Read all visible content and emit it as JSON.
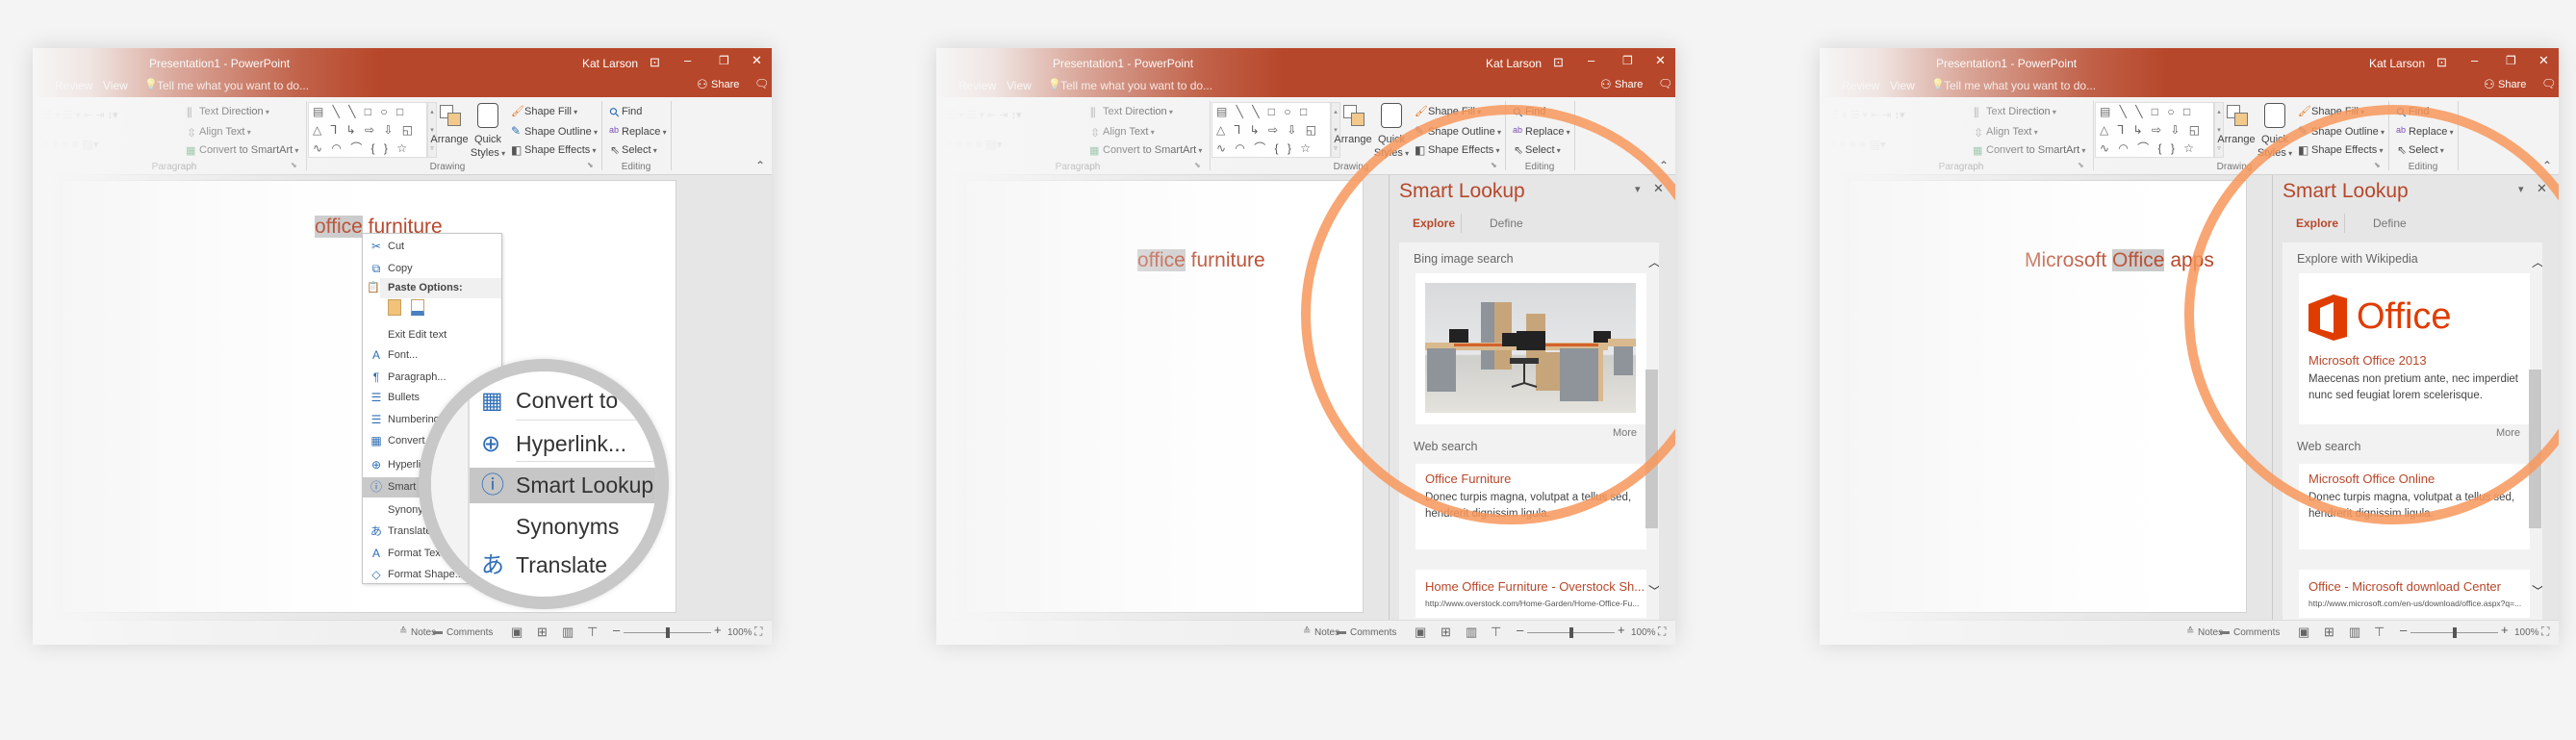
{
  "window": {
    "title": "Presentation1 - PowerPoint",
    "user": "Kat Larson",
    "tabs": [
      "Review",
      "View"
    ],
    "tell_me": "Tell me what you want to do...",
    "share": "Share"
  },
  "ribbon": {
    "text_direction": "Text Direction",
    "align_text": "Align Text",
    "convert_smartart": "Convert to SmartArt",
    "paragraph_group": "Paragraph",
    "shape_gallery_rows": [
      "▤ ╲ ╲ □ ○ □",
      "△ ⅂ ↳ ⇨ ⇩ ◱",
      "∿ ◠ ⌒ { } ☆"
    ],
    "arrange": "Arrange",
    "quick_styles_1": "Quick",
    "quick_styles_2": "Styles",
    "shape_fill": "Shape Fill",
    "shape_outline": "Shape Outline",
    "shape_effects": "Shape Effects",
    "drawing_group": "Drawing",
    "find": "Find",
    "replace": "Replace",
    "select": "Select",
    "editing_group": "Editing"
  },
  "status_bar": {
    "notes": "Notes",
    "comments": "Comments",
    "zoom": "100%",
    "zoom_slider_fraction": 0.5
  },
  "colors": {
    "accent": "#b7472a",
    "highlight_ring": "#f7965a",
    "magnifier_ring": "#c8c8c8"
  },
  "panels": [
    {
      "slide_text": {
        "before": "",
        "highlight": "office",
        "after": " furniture"
      },
      "context_menu": [
        {
          "label": "Cut",
          "icon": "cut-icon"
        },
        {
          "label": "Copy",
          "icon": "copy-icon"
        },
        {
          "label": "Paste Options:",
          "icon": "paste-icon",
          "header": true
        },
        {
          "label": "",
          "icon": "paste-options-icon"
        },
        {
          "label": "Exit Edit text",
          "icon": ""
        },
        {
          "label": "Font...",
          "icon": "font-icon"
        },
        {
          "label": "Paragraph...",
          "icon": "paragraph-icon"
        },
        {
          "label": "Bullets",
          "icon": "bullets-icon"
        },
        {
          "label": "Numbering",
          "icon": "numbering-icon"
        },
        {
          "label": "Convert to SmartArt",
          "icon": "smartart-icon"
        },
        {
          "label": "Hyperlink...",
          "icon": "hyperlink-icon"
        },
        {
          "label": "Smart Lookup",
          "icon": "smart-lookup-icon",
          "selected": true
        },
        {
          "label": "Synonyms",
          "icon": ""
        },
        {
          "label": "Translate",
          "icon": "translate-icon"
        },
        {
          "label": "Format Text Effects...",
          "icon": "text-effects-icon"
        },
        {
          "label": "Format Shape...",
          "icon": "format-shape-icon"
        }
      ],
      "magnifier": [
        {
          "label": "Convert to",
          "icon": "smartart-icon"
        },
        {
          "label": "Hyperlink...",
          "icon": "hyperlink-icon"
        },
        {
          "label": "Smart Lookup",
          "icon": "smart-lookup-icon",
          "selected": true
        },
        {
          "label": "Synonyms",
          "icon": ""
        },
        {
          "label": "Translate",
          "icon": "translate-icon"
        }
      ]
    },
    {
      "slide_text": {
        "before": "",
        "highlight": "office",
        "after": " furniture"
      },
      "smart_lookup": {
        "title": "Smart Lookup",
        "tabs": [
          "Explore",
          "Define"
        ],
        "section_title": "Bing image search",
        "kind": "image",
        "more": "More",
        "web_title": "Web search",
        "results": [
          {
            "title": "Office Furniture",
            "desc": "Donec turpis magna, volutpat a tellus sed, hendrerit dignissim ligula."
          },
          {
            "title": "Home Office Furniture - Overstock Sh...",
            "url": "http://www.overstock.com/Home-Garden/Home-Office-Fu..."
          }
        ]
      }
    },
    {
      "slide_text": {
        "before": "Microsoft ",
        "highlight": "Office",
        "after": " apps"
      },
      "smart_lookup": {
        "title": "Smart Lookup",
        "tabs": [
          "Explore",
          "Define"
        ],
        "section_title": "Explore with Wikipedia",
        "kind": "wiki",
        "logo_text": "Office",
        "wiki_title": "Microsoft Office 2013",
        "wiki_desc": "Maecenas non pretium ante, nec imperdiet nunc sed feugiat lorem scelerisque.",
        "more": "More",
        "web_title": "Web search",
        "results": [
          {
            "title": "Microsoft Office Online",
            "desc": "Donec turpis magna, volutpat a tellus sed, hendrerit dignissim ligula."
          },
          {
            "title": "Office - Microsoft download Center",
            "url": "http://www.microsoft.com/en-us/download/office.aspx?q=..."
          }
        ]
      }
    }
  ]
}
